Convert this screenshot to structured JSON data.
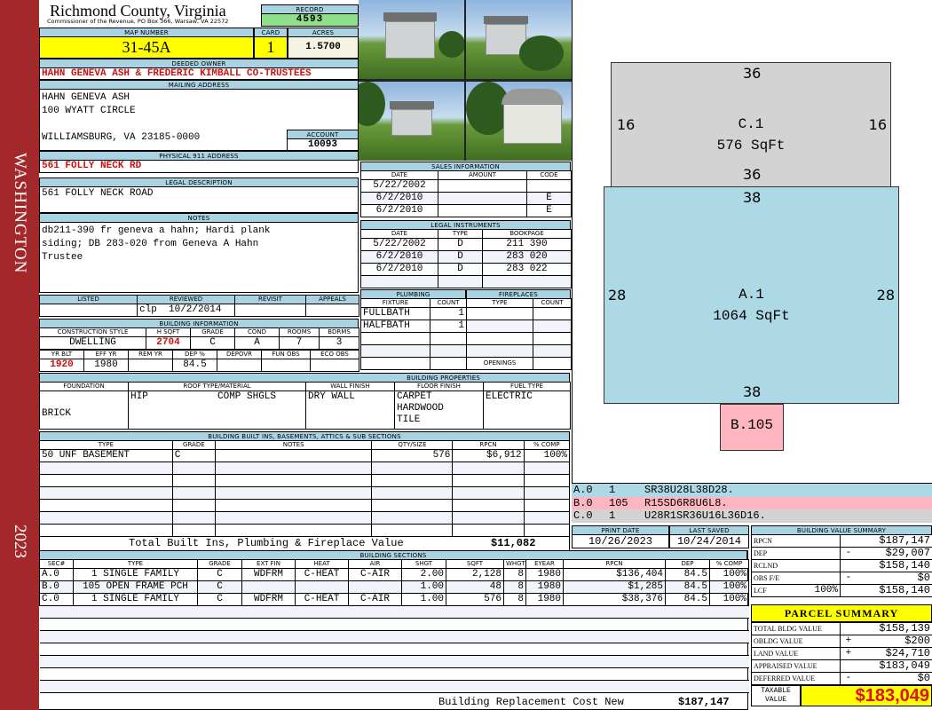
{
  "sidebar": {
    "district": "WASHINGTON",
    "year": "2023"
  },
  "header": {
    "county": "Richmond County, Virginia",
    "subtitle": "Commissioner of the Revenue, PO Box 366, Warsaw, VA 22572",
    "record_label": "RECORD",
    "record": "4593"
  },
  "parcel": {
    "map_label": "MAP NUMBER",
    "map": "31-45A",
    "card_label": "CARD",
    "card": "1",
    "acres_label": "ACRES",
    "acres": "1.5700"
  },
  "owner": {
    "label": "DEEDED OWNER",
    "value": "HAHN GENEVA ASH & FREDERIC KIMBALL CO-TRUSTEES"
  },
  "mailing": {
    "label": "MAILING ADDRESS",
    "line1": "HAHN GENEVA ASH",
    "line2": "100 WYATT CIRCLE",
    "line3": "WILLIAMSBURG, VA 23185-0000",
    "account_label": "ACCOUNT",
    "account": "10093"
  },
  "physical": {
    "label": "PHYSICAL 911 ADDRESS",
    "value": "561 FOLLY NECK RD"
  },
  "legal": {
    "label": "LEGAL DESCRIPTION",
    "value": "561 FOLLY NECK ROAD"
  },
  "notes": {
    "label": "NOTES",
    "value": "db211-390 fr geneva a hahn; Hardi plank siding; DB 283-020 from Geneva A Hahn Trustee"
  },
  "review": {
    "headers": [
      "LISTED",
      "REVIEWED",
      "REVISIT",
      "APPEALS"
    ],
    "listed": "",
    "reviewed": "clp  10/2/2014",
    "revisit": "",
    "appeals": ""
  },
  "building_info": {
    "label": "BUILDING INFORMATION",
    "h1": [
      "CONSTRUCTION STYLE",
      "H SQFT",
      "GRADE",
      "COND",
      "ROOMS",
      "BDRMS"
    ],
    "v1": [
      "DWELLING",
      "2704",
      "C",
      "A",
      "7",
      "3"
    ],
    "h2": [
      "YR BLT",
      "EFF YR",
      "REM YR",
      "DEP %",
      "DEPOVR",
      "FUN OBS",
      "ECO OBS"
    ],
    "v2": [
      "1920",
      "1980",
      "",
      "84.5",
      "",
      "",
      ""
    ]
  },
  "properties": {
    "label": "BUILDING PROPERTIES",
    "headers": [
      "FOUNDATION",
      "ROOF TYPE/MATERIAL",
      "WALL FINISH",
      "FLOOR FINISH",
      "FUEL TYPE"
    ],
    "foundation": "BRICK",
    "roof_type": "HIP",
    "roof_material": "COMP SHGLS",
    "wall": "DRY WALL",
    "floor": [
      "CARPET",
      "HARDWOOD",
      "TILE"
    ],
    "fuel": "ELECTRIC"
  },
  "sales": {
    "label": "SALES INFORMATION",
    "headers": [
      "DATE",
      "AMOUNT",
      "CODE"
    ],
    "rows": [
      {
        "date": "5/22/2002",
        "amount": "",
        "code": ""
      },
      {
        "date": "6/2/2010",
        "amount": "",
        "code": "E"
      },
      {
        "date": "6/2/2010",
        "amount": "",
        "code": "E"
      }
    ]
  },
  "instruments": {
    "label": "LEGAL INSTRUMENTS",
    "headers": [
      "DATE",
      "TYPE",
      "BOOKPAGE"
    ],
    "rows": [
      {
        "date": "5/22/2002",
        "type": "D",
        "bp": "211 390"
      },
      {
        "date": "6/2/2010",
        "type": "D",
        "bp": "283 020"
      },
      {
        "date": "6/2/2010",
        "type": "D",
        "bp": "283 022"
      }
    ]
  },
  "plumbing": {
    "label": "PLUMBING",
    "headers": [
      "FIXTURE",
      "COUNT"
    ],
    "rows": [
      {
        "f": "FULLBATH",
        "c": "1"
      },
      {
        "f": "HALFBATH",
        "c": "1"
      }
    ]
  },
  "fireplaces": {
    "label": "FIREPLACES",
    "headers": [
      "TYPE",
      "COUNT"
    ],
    "openings_label": "OPENINGS",
    "openings": ""
  },
  "builtins": {
    "label": "BUILDING BUILT INS, BASEMENTS, ATTICS & SUB SECTIONS",
    "headers": [
      "TYPE",
      "GRADE",
      "NOTES",
      "QTY/SIZE",
      "RPCN",
      "% COMP"
    ],
    "rows": [
      {
        "type": "50 UNF BASEMENT",
        "grade": "C",
        "notes": "",
        "qty": "576",
        "rpcn": "$6,912",
        "comp": "100%"
      }
    ],
    "total_label": "Total Built Ins, Plumbing & Fireplace Value",
    "total": "$11,082"
  },
  "sections": {
    "label": "BUILDING SECTIONS",
    "headers": [
      "SEC#",
      "TYPE",
      "GRADE",
      "EXT FIN",
      "HEAT",
      "AIR",
      "SHGT",
      "SQFT",
      "WHGT",
      "EYEAR",
      "RPCN",
      "DEP",
      "% COMP"
    ],
    "rows": [
      {
        "sec": "A.0",
        "type": "1 SINGLE FAMILY",
        "grade": "C",
        "ext": "WDFRM",
        "heat": "C-HEAT",
        "air": "C-AIR",
        "shgt": "2.00",
        "sqft": "2,128",
        "whgt": "8",
        "eyear": "1980",
        "rpcn": "$136,404",
        "dep": "84.5",
        "comp": "100%"
      },
      {
        "sec": "B.0",
        "type": "105 OPEN FRAME PCH",
        "grade": "C",
        "ext": "",
        "heat": "",
        "air": "",
        "shgt": "1.00",
        "sqft": "48",
        "whgt": "8",
        "eyear": "1980",
        "rpcn": "$1,285",
        "dep": "84.5",
        "comp": "100%"
      },
      {
        "sec": "C.0",
        "type": "1 SINGLE FAMILY",
        "grade": "C",
        "ext": "WDFRM",
        "heat": "C-HEAT",
        "air": "C-AIR",
        "shgt": "1.00",
        "sqft": "576",
        "whgt": "8",
        "eyear": "1980",
        "rpcn": "$38,376",
        "dep": "84.5",
        "comp": "100%"
      }
    ],
    "rcn_label": "Building Replacement Cost New",
    "rcn": "$187,147"
  },
  "sketch": {
    "C": {
      "label": "C.1",
      "area": "576 SqFt",
      "top": "36",
      "bottom": "36",
      "left": "16",
      "right": "16"
    },
    "A": {
      "label": "A.1",
      "area": "1064 SqFt",
      "top": "38",
      "bottom": "38",
      "left": "28",
      "right": "28"
    },
    "B": {
      "label": "B.105"
    },
    "legend": [
      {
        "sec": "A.0",
        "code": "1",
        "path": "SR38U28L38D28.",
        "color": "#add8e6"
      },
      {
        "sec": "B.0",
        "code": "105",
        "path": "R15SD6R8U6L8.",
        "color": "#ffb6c1"
      },
      {
        "sec": "C.0",
        "code": "1",
        "path": "U28R1SR36U16L36D16.",
        "color": "#d3d3d3"
      }
    ]
  },
  "dates": {
    "print_label": "PRINT DATE",
    "print": "10/26/2023",
    "saved_label": "LAST SAVED",
    "saved": "10/24/2014"
  },
  "value_summary": {
    "label": "BUILDING VALUE SUMMARY",
    "rows": [
      {
        "k": "RPCN",
        "s": "",
        "v": "$187,147"
      },
      {
        "k": "DEP",
        "s": "-",
        "v": "$29,007"
      },
      {
        "k": "RCLND",
        "s": "",
        "v": "$158,140"
      },
      {
        "k": "OBS F/E",
        "s": "-",
        "v": "$0"
      },
      {
        "k": "LCF",
        "p": "100%",
        "s": "",
        "v": "$158,140"
      }
    ]
  },
  "parcel_summary": {
    "label": "PARCEL SUMMARY",
    "rows": [
      {
        "k": "TOTAL BLDG VALUE",
        "s": "",
        "v": "$158,139"
      },
      {
        "k": "OBLDG VALUE",
        "s": "+",
        "v": "$200"
      },
      {
        "k": "LAND VALUE",
        "s": "+",
        "v": "$24,710"
      },
      {
        "k": "APPRAISED VALUE",
        "s": "",
        "v": "$183,049"
      },
      {
        "k": "DEFERRED VALUE",
        "s": "-",
        "v": "$0"
      }
    ],
    "taxable_label": "TAXABLE VALUE",
    "taxable": "$183,049"
  }
}
